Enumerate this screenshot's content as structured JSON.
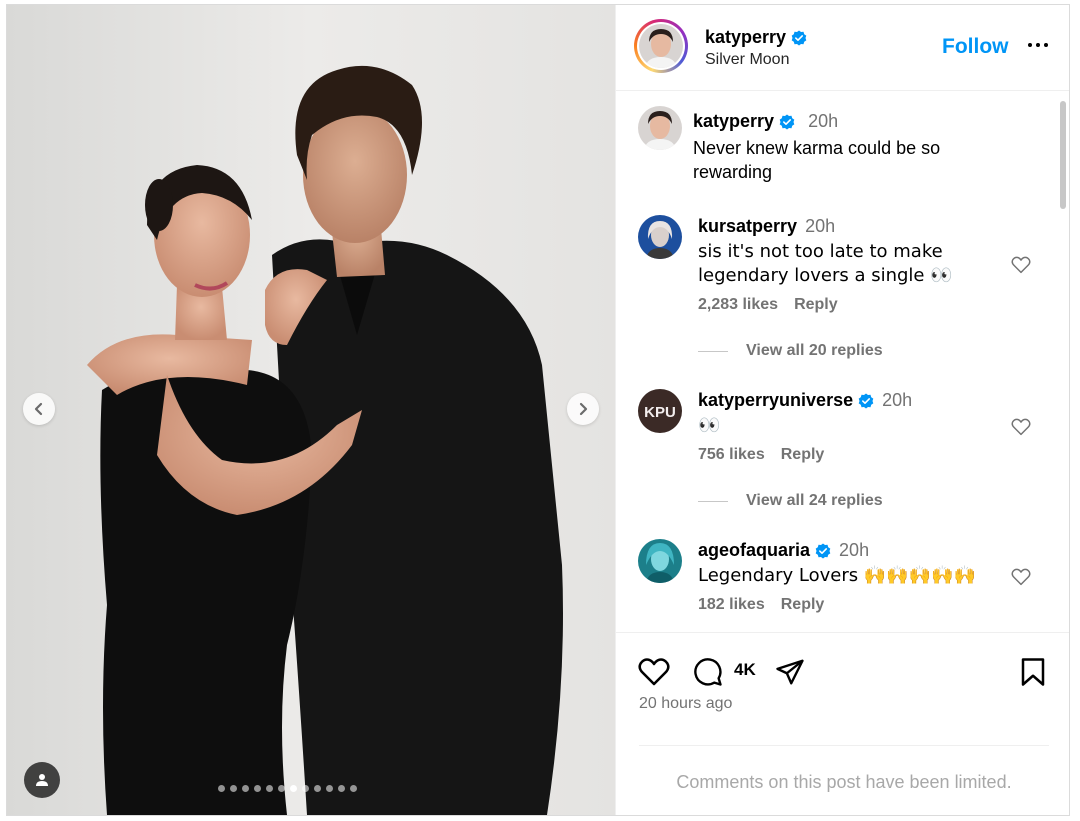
{
  "post": {
    "author": "katyperry",
    "verified": true,
    "location": "Silver Moon",
    "follow_label": "Follow",
    "caption": {
      "username": "katyperry",
      "time": "20h",
      "text": "Never knew karma could be so rewarding"
    },
    "carousel": {
      "total_slides": 12,
      "active_index": 6
    }
  },
  "comments": [
    {
      "username": "kursatperry",
      "verified": false,
      "time": "20h",
      "text": "sis it's not too late to make legendary lovers a single 👀",
      "likes": "2,283 likes",
      "reply_label": "Reply",
      "view_replies": "View all 20 replies"
    },
    {
      "username": "katyperryuniverse",
      "verified": true,
      "time": "20h",
      "text": "👀",
      "likes": "756 likes",
      "reply_label": "Reply",
      "view_replies": "View all 24 replies",
      "avatar_text": "KPU"
    },
    {
      "username": "ageofaquaria",
      "verified": true,
      "time": "20h",
      "text": "Legendary Lovers 🙌🙌🙌🙌🙌",
      "likes": "182 likes",
      "reply_label": "Reply"
    }
  ],
  "actions": {
    "comment_count": "4K",
    "time_ago": "20 hours ago",
    "limited_notice": "Comments on this post have been limited."
  },
  "colors": {
    "accent": "#0095f6",
    "verified": "#0095f6",
    "secondary_text": "#737373"
  },
  "icons": [
    "chevron-left-icon",
    "chevron-right-icon",
    "user-tag-icon",
    "more-icon",
    "heart-icon",
    "comment-icon",
    "share-icon",
    "bookmark-icon",
    "verified-badge-icon"
  ]
}
